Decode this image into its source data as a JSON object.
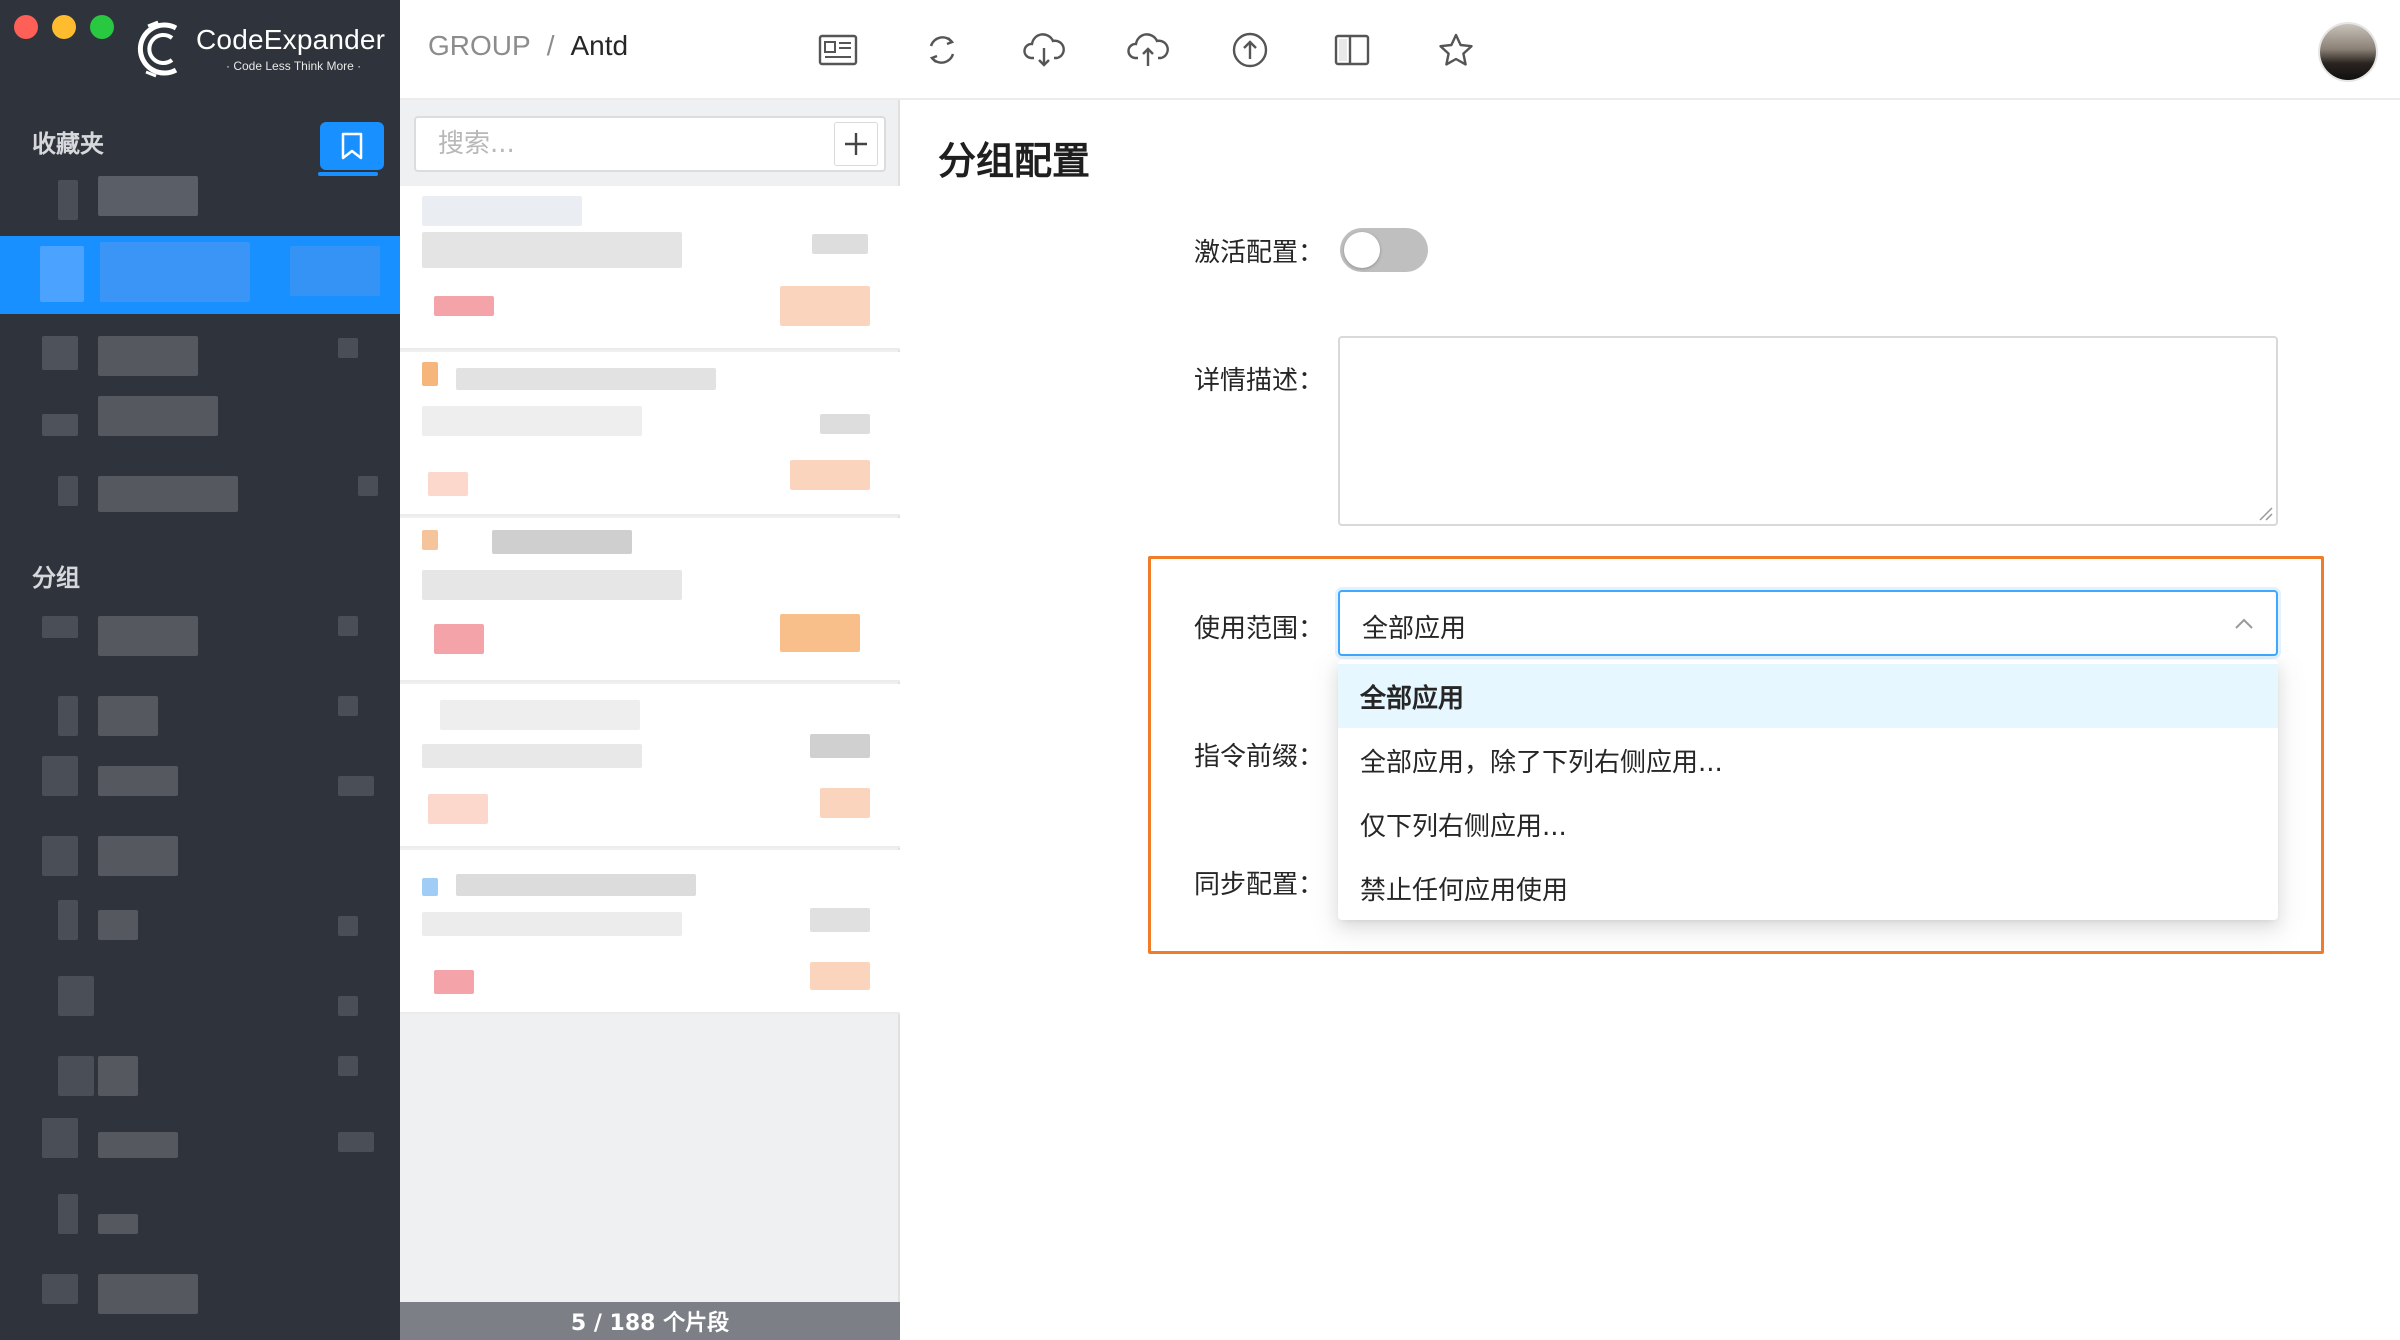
{
  "app": {
    "logo_name": "CodeExpander",
    "logo_tagline": "· Code Less Think More ·"
  },
  "sidebar": {
    "favorites_label": "收藏夹",
    "groups_label": "分组"
  },
  "header": {
    "breadcrumb": [
      "GROUP",
      "/",
      "Antd"
    ],
    "toolbar_icons": [
      "snippet-card-icon",
      "sync-icon",
      "cloud-download-icon",
      "cloud-upload-icon",
      "upload-circle-icon",
      "book-icon",
      "star-icon"
    ]
  },
  "list": {
    "search_placeholder": "搜索...",
    "footer": "5 / 188 个片段"
  },
  "form": {
    "title": "分组配置",
    "activate_label": "激活配置：",
    "activate_on": false,
    "description_label": "详情描述：",
    "description_value": "",
    "scope_label": "使用范围：",
    "scope_value": "全部应用",
    "prefix_label": "指令前缀：",
    "sync_label": "同步配置：",
    "scope_options": [
      {
        "label": "全部应用",
        "selected": true
      },
      {
        "label": "全部应用，除了下列右侧应用...",
        "selected": false
      },
      {
        "label": "仅下列右侧应用...",
        "selected": false
      },
      {
        "label": "禁止任何应用使用",
        "selected": false
      }
    ]
  },
  "colors": {
    "accent": "#1890ff",
    "sidebar_bg": "#2f333b",
    "highlight_border": "#f07c2a"
  }
}
